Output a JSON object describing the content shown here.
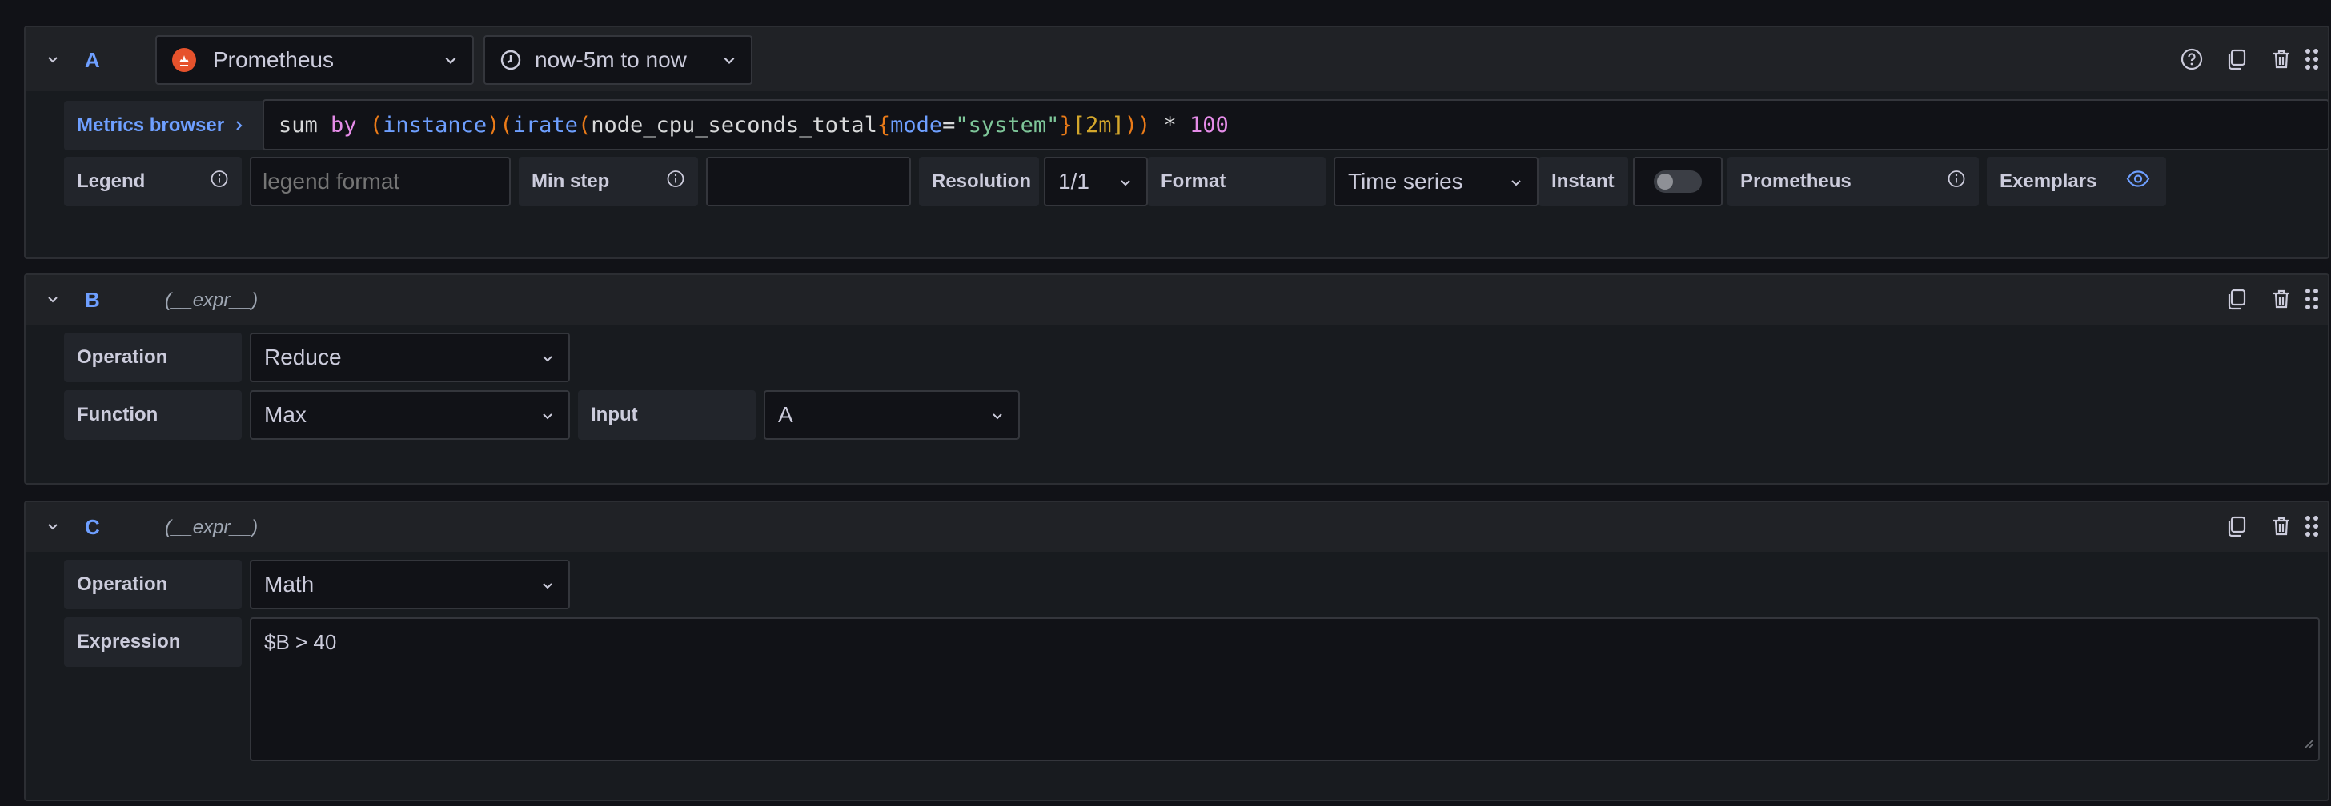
{
  "queries": {
    "a": {
      "ref_id": "A",
      "datasource": "Prometheus",
      "time_range": "now-5m to now",
      "metrics_browser_label": "Metrics browser",
      "query_tokens": [
        {
          "text": "sum ",
          "cls": ""
        },
        {
          "text": "by ",
          "cls": "t-kw"
        },
        {
          "text": "(",
          "cls": "t-paren"
        },
        {
          "text": "instance",
          "cls": "t-fn"
        },
        {
          "text": ")",
          "cls": "t-paren"
        },
        {
          "text": "(",
          "cls": "t-paren"
        },
        {
          "text": "irate",
          "cls": "t-fn"
        },
        {
          "text": "(",
          "cls": "t-paren"
        },
        {
          "text": "node_cpu_seconds_total",
          "cls": ""
        },
        {
          "text": "{",
          "cls": "t-brace"
        },
        {
          "text": "mode",
          "cls": "t-lbl"
        },
        {
          "text": "=",
          "cls": ""
        },
        {
          "text": "\"system\"",
          "cls": "t-str"
        },
        {
          "text": "}",
          "cls": "t-brace"
        },
        {
          "text": "[2m]",
          "cls": "t-rng"
        },
        {
          "text": "))",
          "cls": "t-paren"
        },
        {
          "text": " * ",
          "cls": ""
        },
        {
          "text": "100",
          "cls": "t-num"
        }
      ],
      "options": {
        "legend_label": "Legend",
        "legend_placeholder": "legend format",
        "legend_value": "",
        "min_step_label": "Min step",
        "min_step_value": "",
        "resolution_label": "Resolution",
        "resolution_value": "1/1",
        "format_label": "Format",
        "format_value": "Time series",
        "instant_label": "Instant",
        "instant_enabled": false,
        "type_label": "Prometheus",
        "exemplars_label": "Exemplars"
      }
    },
    "b": {
      "ref_id": "B",
      "expr_label": "(__expr__)",
      "operation_label": "Operation",
      "operation_value": "Reduce",
      "function_label": "Function",
      "function_value": "Max",
      "input_label": "Input",
      "input_value": "A"
    },
    "c": {
      "ref_id": "C",
      "expr_label": "(__expr__)",
      "operation_label": "Operation",
      "operation_value": "Math",
      "expression_label": "Expression",
      "expression_value": "$B > 40"
    }
  },
  "icons": {
    "collapse": "chevron-down-icon",
    "help": "help-circle-icon",
    "duplicate": "copy-icon",
    "delete": "trash-icon",
    "drag": "drag-handle-icon",
    "datasource": "prometheus-logo-icon",
    "clock": "clock-icon",
    "info": "info-circle-icon",
    "eye": "eye-icon"
  },
  "colors": {
    "accent": "#6e9fff",
    "background": "#111217",
    "panel": "#181b1f",
    "prometheus": "#e6522c"
  }
}
